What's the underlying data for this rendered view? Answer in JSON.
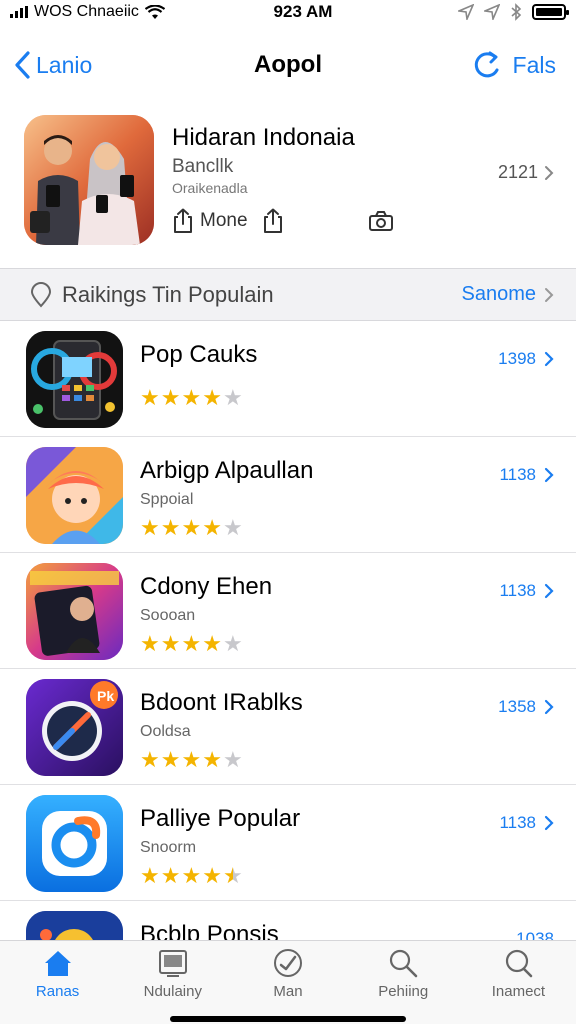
{
  "status": {
    "carrier": "WOS Chnaeiic",
    "time": "923 AM"
  },
  "nav": {
    "back_label": "Lanio",
    "title": "Aopol",
    "right_label": "Fals"
  },
  "featured": {
    "title": "Hidaran Indonaia",
    "subtitle": "Bancllk",
    "caption": "Oraikenadla",
    "count": "2121",
    "actions": [
      {
        "label": "Mone",
        "icon": "share-icon"
      },
      {
        "label": "",
        "icon": "share-icon"
      },
      {
        "label": "",
        "icon": "camera-icon"
      }
    ]
  },
  "section": {
    "title": "Raikings Tin Populain",
    "action_label": "Sanome"
  },
  "apps": [
    {
      "name": "Pop Cauks",
      "subtitle": "",
      "rating": 4,
      "count": "1398",
      "icon": "pop-cauks-icon"
    },
    {
      "name": "Arbigp Alpaullan",
      "subtitle": "Sppoial",
      "rating": 4,
      "count": "1138",
      "icon": "arbigp-icon"
    },
    {
      "name": "Cdony Ehen",
      "subtitle": "Soooan",
      "rating": 4,
      "count": "1138",
      "icon": "cdony-icon"
    },
    {
      "name": "Bdoont IRablks",
      "subtitle": "Ooldsa",
      "rating": 4,
      "count": "1358",
      "icon": "bdoont-icon"
    },
    {
      "name": "Palliye Popular",
      "subtitle": "Snoorm",
      "rating": 4.5,
      "count": "1138",
      "icon": "palliye-icon"
    },
    {
      "name": "Bcblp Ponsis",
      "subtitle": "",
      "rating": 0,
      "count": "1038",
      "icon": "bcblp-icon"
    }
  ],
  "tabs": [
    {
      "label": "Ranas",
      "icon": "home-icon",
      "active": true
    },
    {
      "label": "Ndulainy",
      "icon": "screen-icon",
      "active": false
    },
    {
      "label": "Man",
      "icon": "compass-icon",
      "active": false
    },
    {
      "label": "Pehiing",
      "icon": "search-icon",
      "active": false
    },
    {
      "label": "Inamect",
      "icon": "search-icon",
      "active": false
    }
  ],
  "colors": {
    "accent": "#1a7df0",
    "star": "#f4b400"
  }
}
